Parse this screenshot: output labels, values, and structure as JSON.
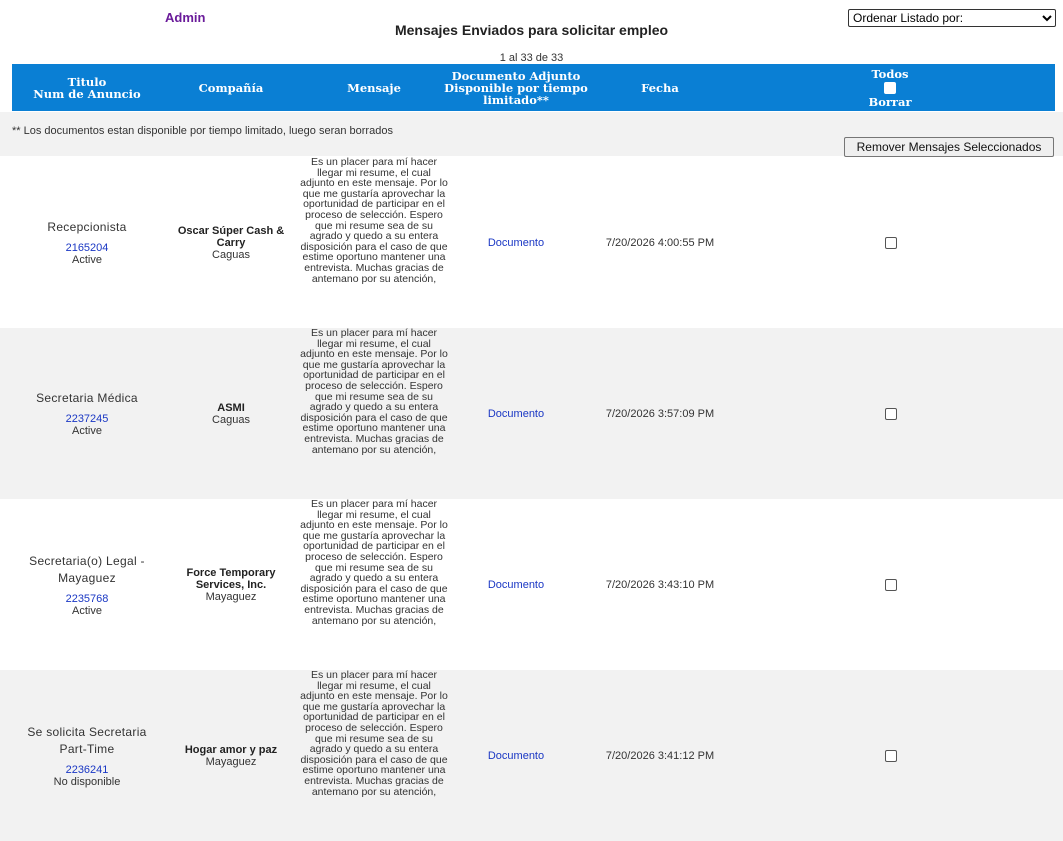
{
  "header": {
    "admin_label": "Admin",
    "title": "Mensajes Enviados para solicitar empleo",
    "sort_selected": "Ordenar Listado por:",
    "count": "1 al 33 de 33"
  },
  "columns": {
    "title_line1": "Titulo",
    "title_line2": "Num de Anuncio",
    "company": "Compañía",
    "message": "Mensaje",
    "doc_line1": "Documento Adjunto",
    "doc_line2": "Disponible por tiempo",
    "doc_line3": "limitado**",
    "date": "Fecha",
    "all_line1": "Todos",
    "all_line2": "Borrar"
  },
  "notice": "** Los documentos estan disponible por tiempo limitado, luego seran borrados",
  "remove_button": "Remover Mensajes Seleccionados",
  "rows": [
    {
      "title": "Recepcionista",
      "id": "2165204",
      "status": "Active",
      "company": "Oscar Súper Cash & Carry",
      "city": "Caguas",
      "message": "Es un placer para mí hacer llegar mi resume, el cual adjunto en este mensaje. Por lo que me gustaría aprovechar la oportunidad de participar en el proceso de selección. Espero que mi resume sea de su agrado y quedo a su entera disposición para el caso de que estime oportuno mantener una entrevista. Muchas gracias de antemano por su atención,",
      "document": "Documento",
      "date": "7/20/2026 4:00:55 PM"
    },
    {
      "title": "Secretaria Médica",
      "id": "2237245",
      "status": "Active",
      "company": "ASMI",
      "city": "Caguas",
      "message": "Es un placer para mí hacer llegar mi resume, el cual adjunto en este mensaje. Por lo que me gustaría aprovechar la oportunidad de participar en el proceso de selección. Espero que mi resume sea de su agrado y quedo a su entera disposición para el caso de que estime oportuno mantener una entrevista. Muchas gracias de antemano por su atención,",
      "document": "Documento",
      "date": "7/20/2026 3:57:09 PM"
    },
    {
      "title": "Secretaria(o) Legal - Mayaguez",
      "id": "2235768",
      "status": "Active",
      "company": "Force Temporary Services, Inc.",
      "city": "Mayaguez",
      "message": "Es un placer para mí hacer llegar mi resume, el cual adjunto en este mensaje. Por lo que me gustaría aprovechar la oportunidad de participar en el proceso de selección. Espero que mi resume sea de su agrado y quedo a su entera disposición para el caso de que estime oportuno mantener una entrevista. Muchas gracias de antemano por su atención,",
      "document": "Documento",
      "date": "7/20/2026 3:43:10 PM"
    },
    {
      "title": "Se solicita Secretaria Part-Time",
      "id": "2236241",
      "status": "No disponible",
      "company": "Hogar amor y paz",
      "city": "Mayaguez",
      "message": "Es un placer para mí hacer llegar mi resume, el cual adjunto en este mensaje. Por lo que me gustaría aprovechar la oportunidad de participar en el proceso de selección. Espero que mi resume sea de su agrado y quedo a su entera disposición para el caso de que estime oportuno mantener una entrevista. Muchas gracias de antemano por su atención,",
      "document": "Documento",
      "date": "7/20/2026 3:41:12 PM"
    }
  ]
}
